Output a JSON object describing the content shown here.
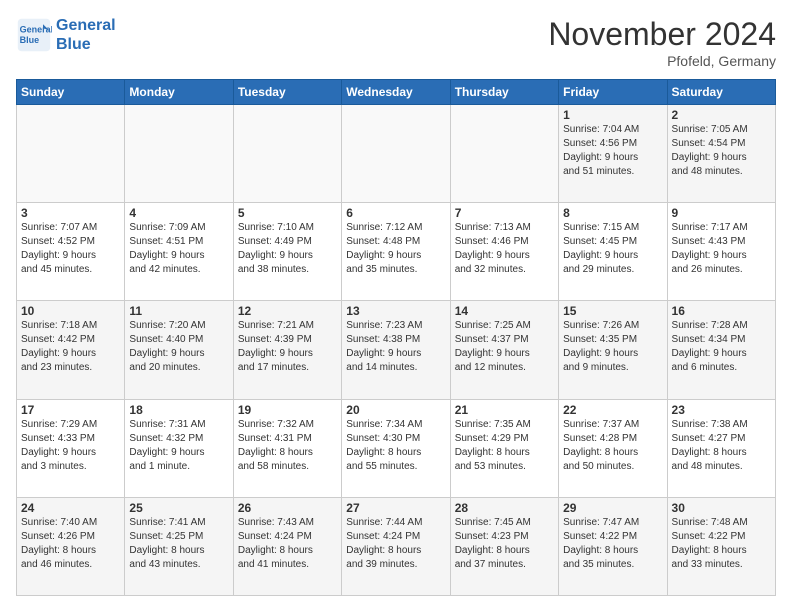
{
  "logo": {
    "line1": "General",
    "line2": "Blue"
  },
  "title": "November 2024",
  "location": "Pfofeld, Germany",
  "weekdays": [
    "Sunday",
    "Monday",
    "Tuesday",
    "Wednesday",
    "Thursday",
    "Friday",
    "Saturday"
  ],
  "weeks": [
    [
      {
        "day": "",
        "info": ""
      },
      {
        "day": "",
        "info": ""
      },
      {
        "day": "",
        "info": ""
      },
      {
        "day": "",
        "info": ""
      },
      {
        "day": "",
        "info": ""
      },
      {
        "day": "1",
        "info": "Sunrise: 7:04 AM\nSunset: 4:56 PM\nDaylight: 9 hours\nand 51 minutes."
      },
      {
        "day": "2",
        "info": "Sunrise: 7:05 AM\nSunset: 4:54 PM\nDaylight: 9 hours\nand 48 minutes."
      }
    ],
    [
      {
        "day": "3",
        "info": "Sunrise: 7:07 AM\nSunset: 4:52 PM\nDaylight: 9 hours\nand 45 minutes."
      },
      {
        "day": "4",
        "info": "Sunrise: 7:09 AM\nSunset: 4:51 PM\nDaylight: 9 hours\nand 42 minutes."
      },
      {
        "day": "5",
        "info": "Sunrise: 7:10 AM\nSunset: 4:49 PM\nDaylight: 9 hours\nand 38 minutes."
      },
      {
        "day": "6",
        "info": "Sunrise: 7:12 AM\nSunset: 4:48 PM\nDaylight: 9 hours\nand 35 minutes."
      },
      {
        "day": "7",
        "info": "Sunrise: 7:13 AM\nSunset: 4:46 PM\nDaylight: 9 hours\nand 32 minutes."
      },
      {
        "day": "8",
        "info": "Sunrise: 7:15 AM\nSunset: 4:45 PM\nDaylight: 9 hours\nand 29 minutes."
      },
      {
        "day": "9",
        "info": "Sunrise: 7:17 AM\nSunset: 4:43 PM\nDaylight: 9 hours\nand 26 minutes."
      }
    ],
    [
      {
        "day": "10",
        "info": "Sunrise: 7:18 AM\nSunset: 4:42 PM\nDaylight: 9 hours\nand 23 minutes."
      },
      {
        "day": "11",
        "info": "Sunrise: 7:20 AM\nSunset: 4:40 PM\nDaylight: 9 hours\nand 20 minutes."
      },
      {
        "day": "12",
        "info": "Sunrise: 7:21 AM\nSunset: 4:39 PM\nDaylight: 9 hours\nand 17 minutes."
      },
      {
        "day": "13",
        "info": "Sunrise: 7:23 AM\nSunset: 4:38 PM\nDaylight: 9 hours\nand 14 minutes."
      },
      {
        "day": "14",
        "info": "Sunrise: 7:25 AM\nSunset: 4:37 PM\nDaylight: 9 hours\nand 12 minutes."
      },
      {
        "day": "15",
        "info": "Sunrise: 7:26 AM\nSunset: 4:35 PM\nDaylight: 9 hours\nand 9 minutes."
      },
      {
        "day": "16",
        "info": "Sunrise: 7:28 AM\nSunset: 4:34 PM\nDaylight: 9 hours\nand 6 minutes."
      }
    ],
    [
      {
        "day": "17",
        "info": "Sunrise: 7:29 AM\nSunset: 4:33 PM\nDaylight: 9 hours\nand 3 minutes."
      },
      {
        "day": "18",
        "info": "Sunrise: 7:31 AM\nSunset: 4:32 PM\nDaylight: 9 hours\nand 1 minute."
      },
      {
        "day": "19",
        "info": "Sunrise: 7:32 AM\nSunset: 4:31 PM\nDaylight: 8 hours\nand 58 minutes."
      },
      {
        "day": "20",
        "info": "Sunrise: 7:34 AM\nSunset: 4:30 PM\nDaylight: 8 hours\nand 55 minutes."
      },
      {
        "day": "21",
        "info": "Sunrise: 7:35 AM\nSunset: 4:29 PM\nDaylight: 8 hours\nand 53 minutes."
      },
      {
        "day": "22",
        "info": "Sunrise: 7:37 AM\nSunset: 4:28 PM\nDaylight: 8 hours\nand 50 minutes."
      },
      {
        "day": "23",
        "info": "Sunrise: 7:38 AM\nSunset: 4:27 PM\nDaylight: 8 hours\nand 48 minutes."
      }
    ],
    [
      {
        "day": "24",
        "info": "Sunrise: 7:40 AM\nSunset: 4:26 PM\nDaylight: 8 hours\nand 46 minutes."
      },
      {
        "day": "25",
        "info": "Sunrise: 7:41 AM\nSunset: 4:25 PM\nDaylight: 8 hours\nand 43 minutes."
      },
      {
        "day": "26",
        "info": "Sunrise: 7:43 AM\nSunset: 4:24 PM\nDaylight: 8 hours\nand 41 minutes."
      },
      {
        "day": "27",
        "info": "Sunrise: 7:44 AM\nSunset: 4:24 PM\nDaylight: 8 hours\nand 39 minutes."
      },
      {
        "day": "28",
        "info": "Sunrise: 7:45 AM\nSunset: 4:23 PM\nDaylight: 8 hours\nand 37 minutes."
      },
      {
        "day": "29",
        "info": "Sunrise: 7:47 AM\nSunset: 4:22 PM\nDaylight: 8 hours\nand 35 minutes."
      },
      {
        "day": "30",
        "info": "Sunrise: 7:48 AM\nSunset: 4:22 PM\nDaylight: 8 hours\nand 33 minutes."
      }
    ]
  ],
  "colors": {
    "header_bg": "#2a6db5",
    "header_text": "#ffffff",
    "odd_row": "#f5f5f5",
    "even_row": "#ffffff"
  }
}
